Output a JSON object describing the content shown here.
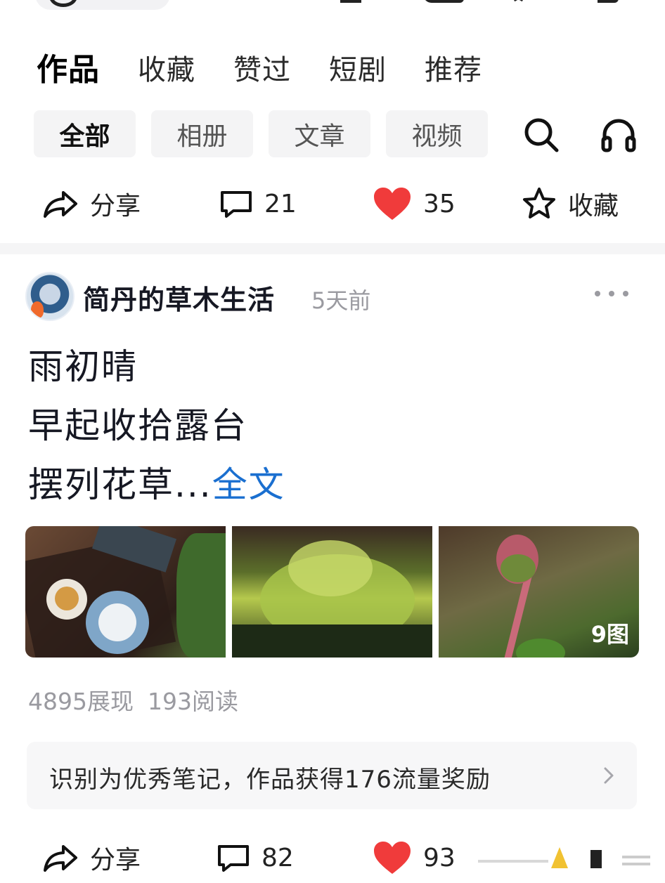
{
  "tabs": [
    {
      "label": "作品",
      "active": true
    },
    {
      "label": "收藏"
    },
    {
      "label": "赞过"
    },
    {
      "label": "短剧"
    },
    {
      "label": "推荐"
    }
  ],
  "filters": [
    {
      "label": "全部",
      "active": true
    },
    {
      "label": "相册"
    },
    {
      "label": "文章"
    },
    {
      "label": "视频"
    }
  ],
  "toolbar_icons": [
    "search-icon",
    "headphones-icon"
  ],
  "prev_post_actions": {
    "share": "分享",
    "comments": "21",
    "likes": "35",
    "favorite": "收藏"
  },
  "post": {
    "author": "简丹的草木生活",
    "time": "5天前",
    "lines": [
      "雨初晴",
      "早起收拾露台",
      "摆列花草..."
    ],
    "more_link": "全文",
    "image_count": "9图",
    "views": "4895展现",
    "reads": "193阅读",
    "notice": "识别为优秀笔记，作品获得176流量奖励",
    "actions": {
      "share": "分享",
      "comments": "82",
      "likes": "93"
    }
  },
  "colors": {
    "like": "#f03b3b",
    "link": "#1a6fd0",
    "muted": "#9a9aa0",
    "chip_bg": "#f4f4f5"
  }
}
